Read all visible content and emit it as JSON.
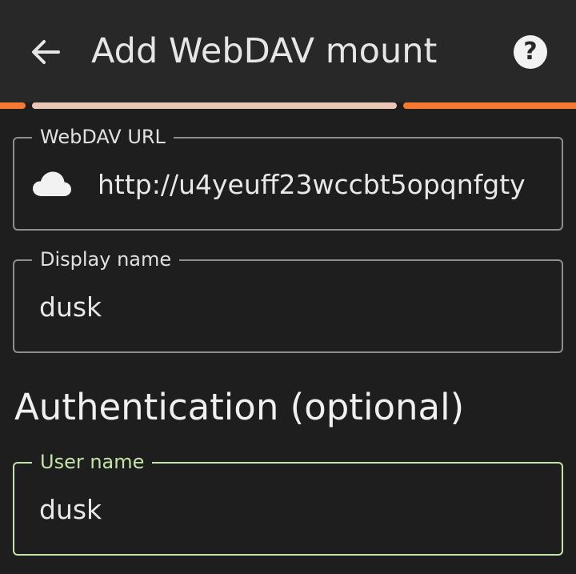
{
  "appbar": {
    "title": "Add WebDAV mount",
    "back_icon": "arrow-left-icon",
    "help_icon": "help-circle-icon"
  },
  "progress": {
    "segments": [
      {
        "state": "done",
        "color": "#f47a30"
      },
      {
        "state": "current",
        "color": "#e8c8b4"
      },
      {
        "state": "done",
        "color": "#f47a30"
      }
    ]
  },
  "fields": {
    "url": {
      "label": "WebDAV URL",
      "value": "http://u4yeuff23wccbt5opqnfgty",
      "icon": "cloud-icon"
    },
    "display_name": {
      "label": "Display name",
      "value": "dusk"
    },
    "user_name": {
      "label": "User name",
      "value": "dusk"
    }
  },
  "authentication": {
    "heading": "Authentication (optional)"
  },
  "colors": {
    "background": "#1e1e1e",
    "appbar": "#282828",
    "accent_orange": "#f47a30",
    "progress_current": "#e8c8b4",
    "focus_green": "#c4e4a7",
    "outline": "#8e8e8e"
  }
}
